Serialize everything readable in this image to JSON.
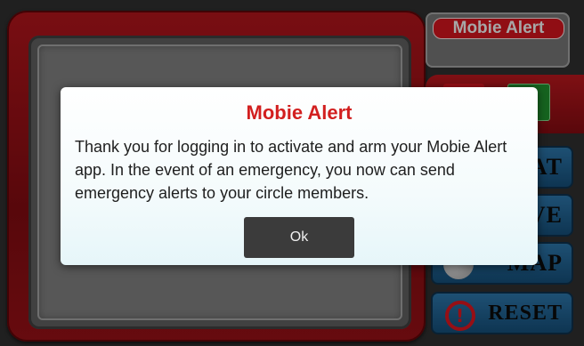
{
  "app": {
    "brand_label": "Mobie Alert",
    "buttons": {
      "chat_label": "CHAT",
      "live_label": "LIVE",
      "map_label": "MAP",
      "reset_label": "RESET"
    }
  },
  "dialog": {
    "title": "Mobie Alert",
    "message": "Thank you for logging in to activate and arm your Mobie Alert app. In the event of an emergency, you now can send emergency alerts to your circle members.",
    "ok_label": "Ok"
  },
  "colors": {
    "accent_red": "#c8141c",
    "title_red": "#d21f1f",
    "button_blue": "#2a6fa0"
  },
  "icons": [
    "map-icon",
    "reset-icon"
  ]
}
